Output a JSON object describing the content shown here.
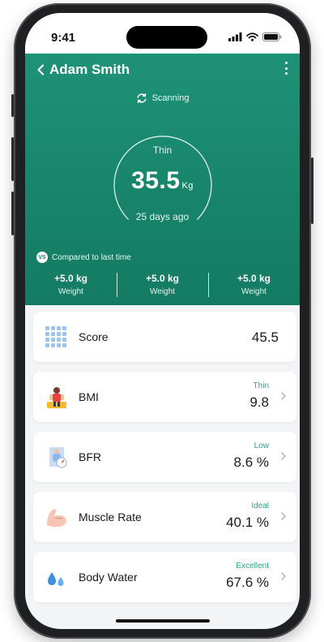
{
  "status_bar": {
    "time": "9:41"
  },
  "header": {
    "back_title": "Adam Smith",
    "scan_status": "Scanning",
    "gauge": {
      "category": "Thin",
      "value": "35.5",
      "unit": "Kg",
      "since": "25 days ago"
    },
    "compare": {
      "badge": "VS",
      "label": "Compared to last time"
    },
    "stats": [
      {
        "value": "+5.0 kg",
        "label": "Weight"
      },
      {
        "value": "+5.0 kg",
        "label": "Weight"
      },
      {
        "value": "+5.0 kg",
        "label": "Weight"
      }
    ]
  },
  "metrics": [
    {
      "name": "Score",
      "status": "",
      "value": "45.5",
      "icon": "grid-icon"
    },
    {
      "name": "BMI",
      "status": "Thin",
      "value": "9.8",
      "icon": "bmi-person-icon"
    },
    {
      "name": "BFR",
      "status": "Low",
      "value": "8.6 %",
      "icon": "body-fat-scale-icon"
    },
    {
      "name": "Muscle Rate",
      "status": "Ideal",
      "value": "40.1 %",
      "icon": "muscle-arm-icon"
    },
    {
      "name": "Body Water",
      "status": "Excellent",
      "value": "67.6 %",
      "icon": "water-drops-icon"
    }
  ],
  "colors": {
    "primary": "#178469",
    "accent_text": "#2aa585",
    "background": "#f3f4f6"
  }
}
